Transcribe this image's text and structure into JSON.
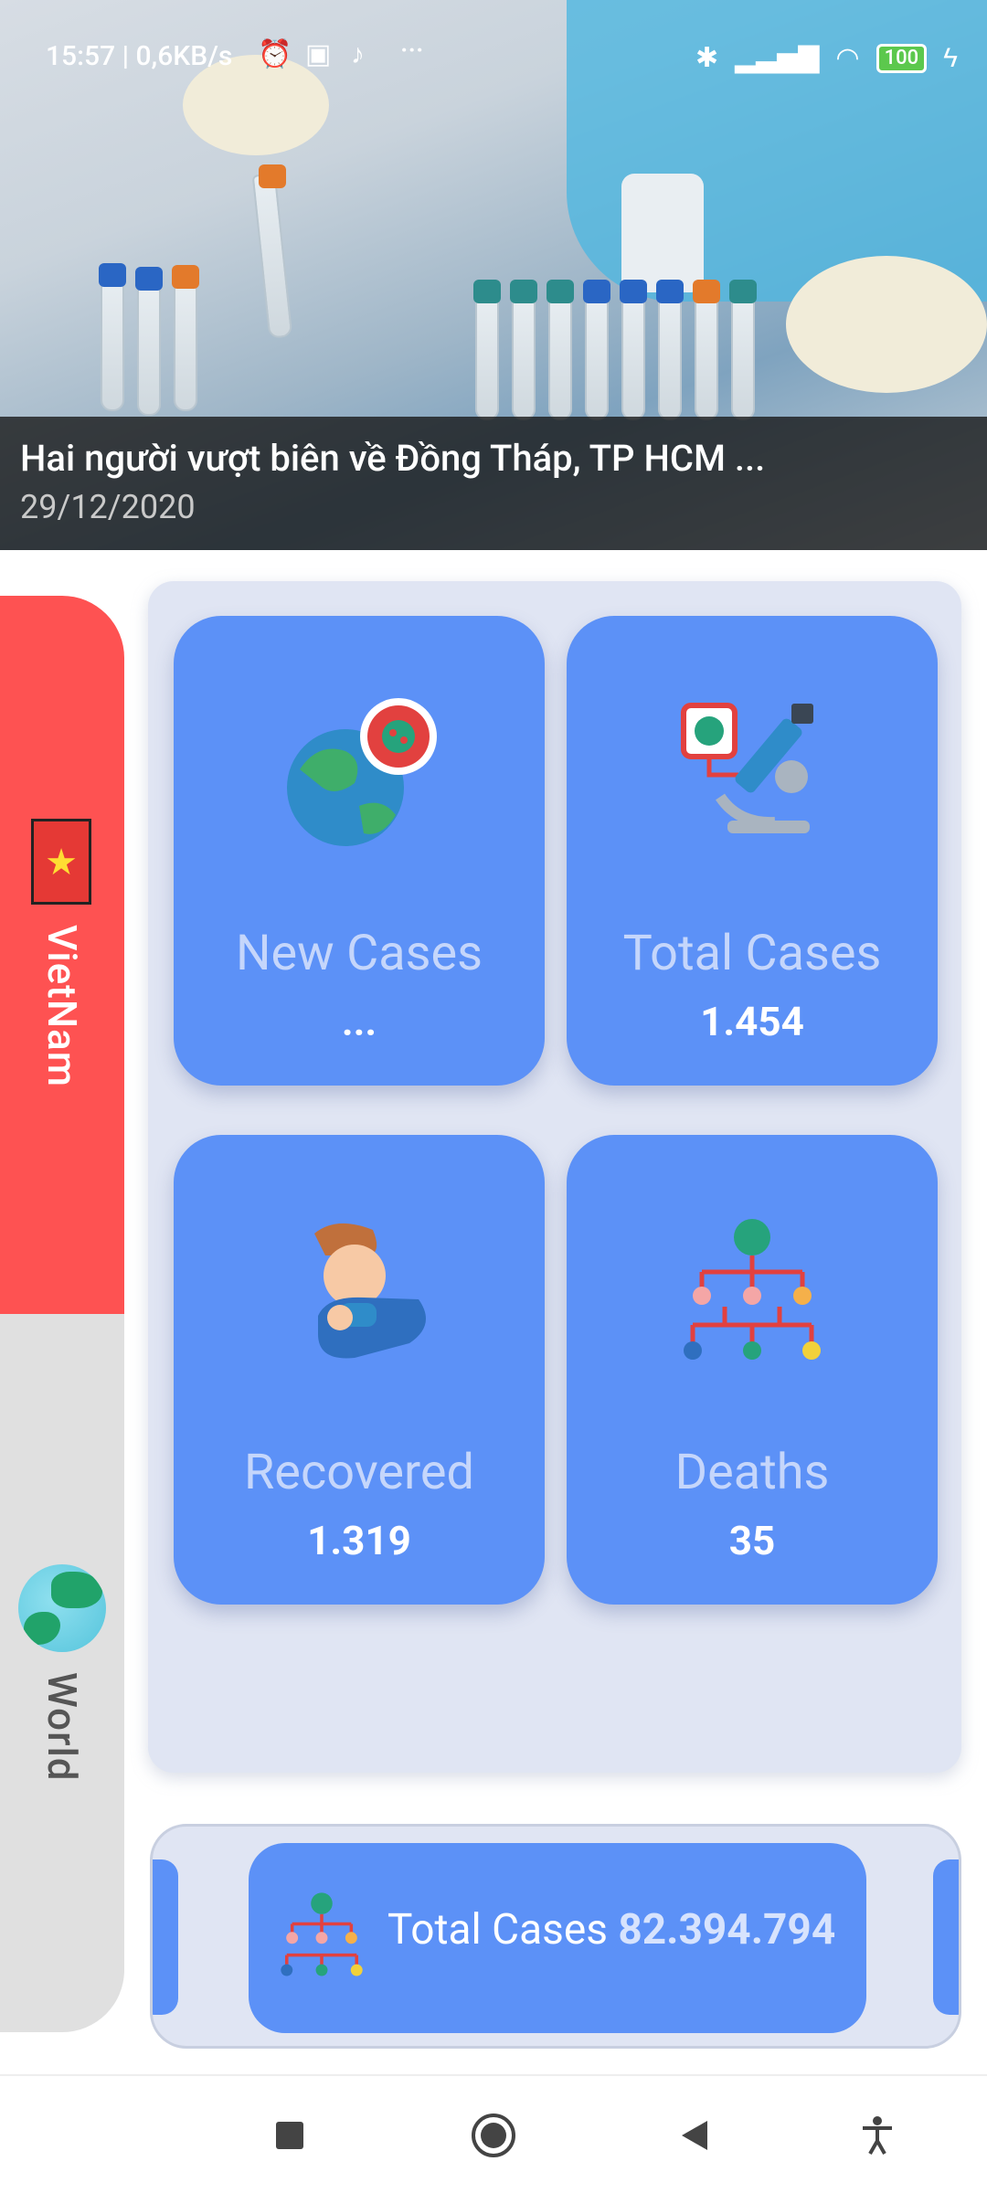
{
  "status_bar": {
    "time": "15:57 | 0,6KB/s",
    "battery": "100"
  },
  "news": {
    "title": "Hai người vượt biên về Đồng Tháp, TP HCM ...",
    "date": "29/12/2020"
  },
  "tabs": {
    "vietnam_label": "VietNam",
    "world_label": "World"
  },
  "stats": {
    "new_cases": {
      "label": "New Cases",
      "value": "..."
    },
    "total_cases": {
      "label": "Total Cases",
      "value": "1.454"
    },
    "recovered": {
      "label": "Recovered",
      "value": "1.319"
    },
    "deaths": {
      "label": "Deaths",
      "value": "35"
    }
  },
  "carousel": {
    "label": "Total Cases",
    "value": "82.394.794"
  },
  "colors": {
    "card": "#5c91f7",
    "vietnam_tab": "#fe5252",
    "panel": "#e0e5f3"
  }
}
